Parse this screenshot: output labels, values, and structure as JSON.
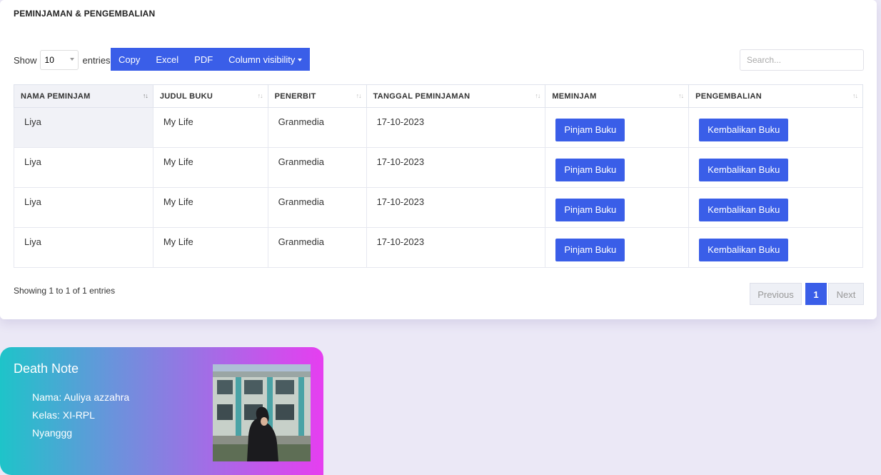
{
  "card": {
    "title": "PEMINJAMAN & PENGEMBALIAN"
  },
  "length": {
    "show": "Show",
    "value": "10",
    "entries": "entries"
  },
  "buttons": {
    "copy": "Copy",
    "excel": "Excel",
    "pdf": "PDF",
    "visibility": "Column visibility"
  },
  "search": {
    "placeholder": "Search..."
  },
  "table": {
    "headers": [
      "NAMA PEMINJAM",
      "JUDUL BUKU",
      "PENERBIT",
      "TANGGAL PEMINJAMAN",
      "MEMINJAM",
      "PENGEMBALIAN"
    ],
    "sorted_column": "NAMA PEMINJAM",
    "rows": [
      {
        "nama": "Liya",
        "judul": "My Life",
        "penerbit": "Granmedia",
        "tanggal": "17-10-2023",
        "pinjam": "Pinjam Buku",
        "kembali": "Kembalikan Buku"
      },
      {
        "nama": "Liya",
        "judul": "My Life",
        "penerbit": "Granmedia",
        "tanggal": "17-10-2023",
        "pinjam": "Pinjam Buku",
        "kembali": "Kembalikan Buku"
      },
      {
        "nama": "Liya",
        "judul": "My Life",
        "penerbit": "Granmedia",
        "tanggal": "17-10-2023",
        "pinjam": "Pinjam Buku",
        "kembali": "Kembalikan Buku"
      },
      {
        "nama": "Liya",
        "judul": "My Life",
        "penerbit": "Granmedia",
        "tanggal": "17-10-2023",
        "pinjam": "Pinjam Buku",
        "kembali": "Kembalikan Buku"
      }
    ]
  },
  "info": "Showing 1 to 1 of 1 entries",
  "pagination": {
    "previous": "Previous",
    "current": "1",
    "next": "Next"
  },
  "profile": {
    "title": "Death Note",
    "nama": "Nama: Auliya azzahra",
    "kelas": "Kelas: XI-RPL",
    "note": "Nyanggg",
    "photo_icon": "profile-photo"
  },
  "colors": {
    "accent": "#3a5ee8",
    "background": "#ebe8f6"
  }
}
